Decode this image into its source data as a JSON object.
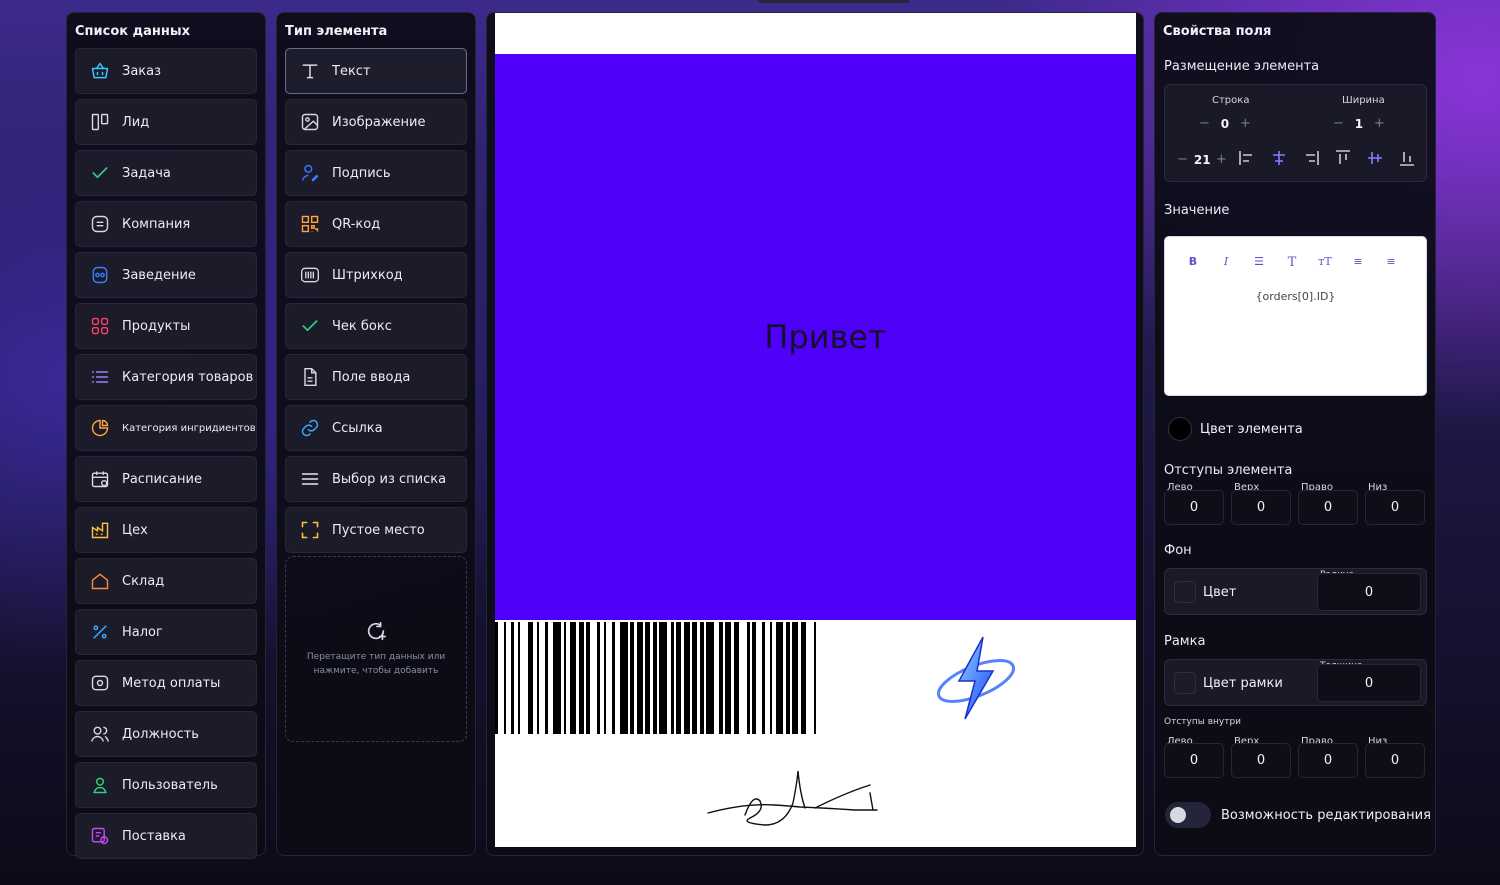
{
  "data_panel": {
    "title": "Список данных",
    "items": [
      {
        "label": "Заказ",
        "icon": "basket-icon"
      },
      {
        "label": "Лид",
        "icon": "columns-icon"
      },
      {
        "label": "Задача",
        "icon": "check-icon"
      },
      {
        "label": "Компания",
        "icon": "company-icon"
      },
      {
        "label": "Заведение",
        "icon": "venue-icon"
      },
      {
        "label": "Продукты",
        "icon": "grid-icon"
      },
      {
        "label": "Категория товаров",
        "icon": "list-icon"
      },
      {
        "label": "Категория ингридиентов",
        "icon": "pie-icon"
      },
      {
        "label": "Расписание",
        "icon": "calendar-icon"
      },
      {
        "label": "Цех",
        "icon": "factory-icon"
      },
      {
        "label": "Склад",
        "icon": "home-icon"
      },
      {
        "label": "Налог",
        "icon": "percent-icon"
      },
      {
        "label": "Метод оплаты",
        "icon": "payment-icon"
      },
      {
        "label": "Должность",
        "icon": "users-icon"
      },
      {
        "label": "Пользователь",
        "icon": "user-icon"
      },
      {
        "label": "Поставка",
        "icon": "delivery-icon"
      }
    ]
  },
  "types_panel": {
    "title": "Тип элемента",
    "items": [
      {
        "label": "Текст",
        "icon": "text-icon"
      },
      {
        "label": "Изображение",
        "icon": "image-icon"
      },
      {
        "label": "Подпись",
        "icon": "signature-icon"
      },
      {
        "label": "QR-код",
        "icon": "qr-icon"
      },
      {
        "label": "Штрихкод",
        "icon": "barcode-icon"
      },
      {
        "label": "Чек бокс",
        "icon": "check-icon"
      },
      {
        "label": "Поле ввода",
        "icon": "document-icon"
      },
      {
        "label": "Ссылка",
        "icon": "link-icon"
      },
      {
        "label": "Выбор из списка",
        "icon": "menu-icon"
      },
      {
        "label": "Пустое место",
        "icon": "frame-icon"
      }
    ],
    "dropzone_text": "Перетащите тип данных или нажмите, чтобы добавить"
  },
  "canvas": {
    "banner_text": "Привет",
    "banner_color": "#4f00f8"
  },
  "props": {
    "title": "Свойства поля",
    "placement_title": "Размещение элемента",
    "row_label": "Строка",
    "row_value": "0",
    "width_label": "Ширина",
    "width_value": "1",
    "size_value": "21",
    "value_title": "Значение",
    "editor_content": "{orders[0].ID}",
    "element_color_label": "Цвет элемента",
    "margins_title": "Отступы элемента",
    "margins": [
      {
        "label": "Лево",
        "value": "0"
      },
      {
        "label": "Верх",
        "value": "0"
      },
      {
        "label": "Право",
        "value": "0"
      },
      {
        "label": "Низ",
        "value": "0"
      }
    ],
    "bg_title": "Фон",
    "bg_color_label": "Цвет",
    "radius_label": "Радиус",
    "radius_value": "0",
    "border_title": "Рамка",
    "border_color_label": "Цвет рамки",
    "thickness_label": "Толщина",
    "thickness_value": "0",
    "padding_title": "Отступы внутри",
    "paddings": [
      {
        "label": "Лево",
        "value": "0"
      },
      {
        "label": "Верх",
        "value": "0"
      },
      {
        "label": "Право",
        "value": "0"
      },
      {
        "label": "Низ",
        "value": "0"
      }
    ],
    "editable_label": "Возможность редактирования"
  }
}
